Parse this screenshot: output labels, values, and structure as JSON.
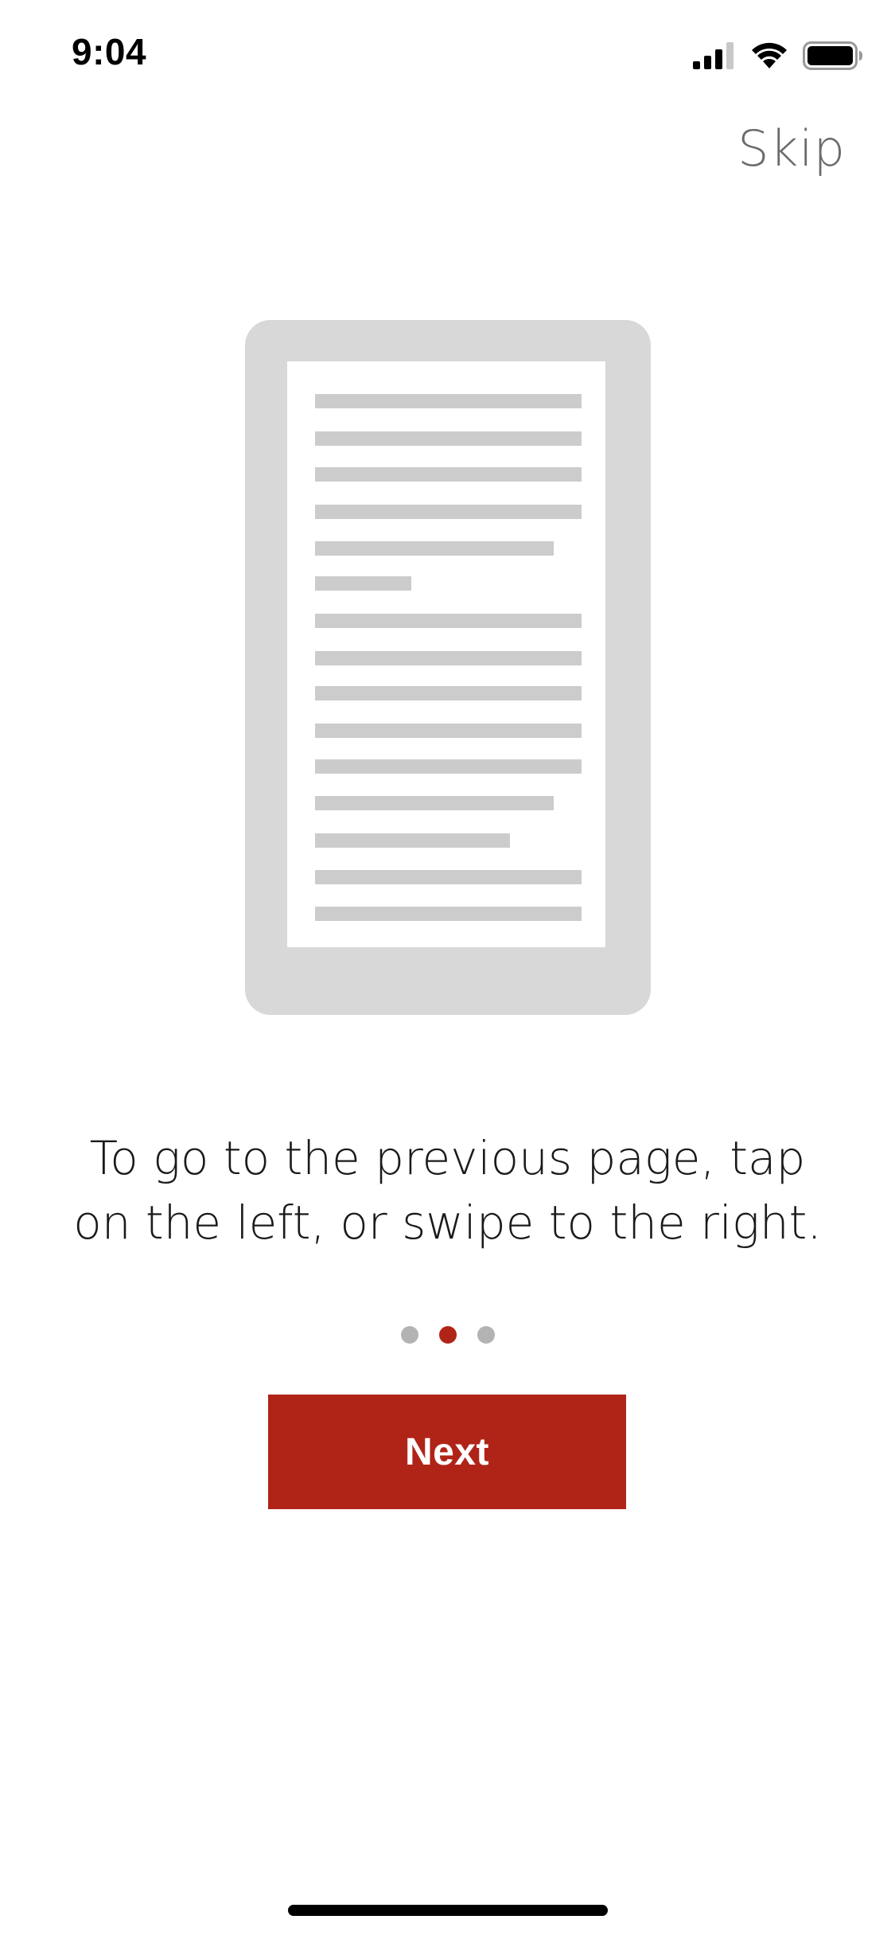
{
  "status_bar": {
    "time": "9:04",
    "icons": [
      "cellular-signal-icon",
      "wifi-icon",
      "battery-icon"
    ]
  },
  "header": {
    "skip_label": "Skip"
  },
  "illustration": {
    "icon": "ereader-page-icon"
  },
  "onboarding": {
    "instruction_line1": "To go to the previous page, tap",
    "instruction_line2": "on the left, or swipe to the right.",
    "page_count": 3,
    "current_page": 2,
    "next_label": "Next"
  },
  "colors": {
    "accent": "#b02418",
    "inactive_dot": "#b3b3b3",
    "device_frame": "#d8d8d8",
    "text_line": "#cccccc",
    "skip_text": "#6b6b6b"
  }
}
